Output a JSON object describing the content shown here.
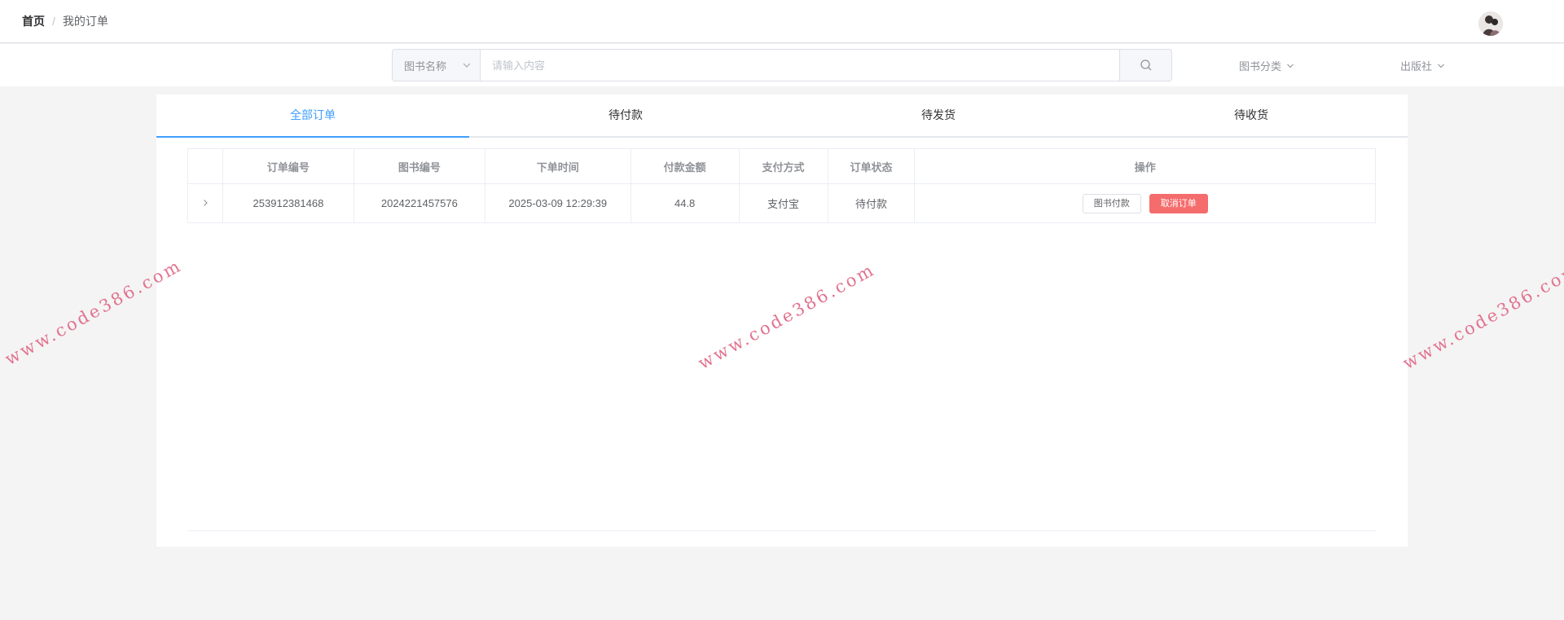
{
  "breadcrumb": {
    "home": "首页",
    "separator": "/",
    "current": "我的订单"
  },
  "search": {
    "select_label": "图书名称",
    "placeholder": "请输入内容",
    "category_label": "图书分类",
    "publisher_label": "出版社"
  },
  "tabs": [
    {
      "label": "全部订单",
      "active": true
    },
    {
      "label": "待付款",
      "active": false
    },
    {
      "label": "待发货",
      "active": false
    },
    {
      "label": "待收货",
      "active": false
    }
  ],
  "table": {
    "headers": [
      "订单编号",
      "图书编号",
      "下单时间",
      "付款金额",
      "支付方式",
      "订单状态",
      "操作"
    ],
    "rows": [
      {
        "order_no": "253912381468",
        "book_no": "2024221457576",
        "time": "2025-03-09 12:29:39",
        "amount": "44.8",
        "pay_method": "支付宝",
        "status": "待付款",
        "pay_button": "图书付款",
        "cancel_button": "取消订单"
      }
    ]
  },
  "watermark": "www.code386.com",
  "colors": {
    "accent": "#409eff",
    "danger": "#f56c6c",
    "watermark": "#e2738f",
    "page_bg": "#f4f4f4"
  }
}
